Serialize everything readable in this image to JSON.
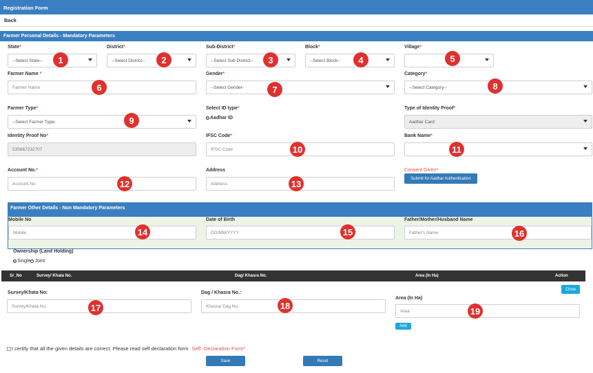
{
  "header": {
    "title": "Registration Form",
    "back_label": "Back"
  },
  "section1": {
    "title": "Farmer Personal Details - Mandatory Parameters"
  },
  "fields": {
    "state": {
      "label": "State",
      "value": "--Select State--"
    },
    "district": {
      "label": "District",
      "value": "--Select District--"
    },
    "sub_district": {
      "label": "Sub-District",
      "value": "--Select Sub District--"
    },
    "block": {
      "label": "Block",
      "value": "--Select Block--"
    },
    "village": {
      "label": "Village",
      "value": ""
    },
    "farmer_name": {
      "label": "Farmer Name",
      "placeholder": "Farmer Name"
    },
    "gender": {
      "label": "Gender",
      "value": "--Select Gender-"
    },
    "category": {
      "label": "Category",
      "value": "--Select Category--"
    },
    "farmer_type": {
      "label": "Farmer Type",
      "value": "--Select Farmer Type-"
    },
    "id_type": {
      "label": "Select ID type",
      "option": "Aadhar ID"
    },
    "identity_proof_type": {
      "label": "Type of Identity Proof",
      "value": "Aadhar Card"
    },
    "identity_proof_no": {
      "label": "Identity Proof No",
      "value": "535667232707"
    },
    "ifsc": {
      "label": "IFSC Code",
      "placeholder": "IFSC Code"
    },
    "bank_name": {
      "label": "Bank Name",
      "value": ""
    },
    "account_no": {
      "label": "Account No.",
      "placeholder": "Account No"
    },
    "address": {
      "label": "Address",
      "placeholder": "Address"
    },
    "consent": {
      "label": "Consent Given",
      "button_label": "Submit for Aadhar Authentication"
    }
  },
  "section2": {
    "title": "Farmer Other Details - Non Mandatory Parameters"
  },
  "other": {
    "mobile": {
      "label": "Mobile No",
      "placeholder": "Mobile"
    },
    "dob": {
      "label": "Date of Birth",
      "placeholder": "DD/MM/YYYY"
    },
    "father": {
      "label": "Father/Mother/Husband Name",
      "placeholder": "Father's Name"
    },
    "ownership": {
      "label": "Ownership (Land Holding)",
      "single": "Single",
      "joint": "Joint"
    }
  },
  "table": {
    "headers": [
      "Sr_No",
      "Survey/ Khata No.",
      "Dag/ Khasra No.",
      "Area (In Ha)",
      "Action"
    ],
    "close_label": "Close"
  },
  "land": {
    "survey": {
      "label": "Survey/Khata No:",
      "placeholder": "Survey/Khata No."
    },
    "dag": {
      "label": "Dag / Khasra No.:",
      "placeholder": "Khasra/ Dag No."
    },
    "area": {
      "label": "Area (In Ha)",
      "placeholder": "Area"
    },
    "add_label": "Add"
  },
  "footer": {
    "declaration": "I certify that all the given details are correct. Please read self declaration form",
    "link": "Self -Declaration Form",
    "save_label": "Save",
    "reset_label": "Reset"
  },
  "markers": [
    "1",
    "2",
    "3",
    "4",
    "5",
    "6",
    "7",
    "8",
    "9",
    "10",
    "11",
    "12",
    "13",
    "14",
    "15",
    "16",
    "17",
    "18",
    "19"
  ],
  "colors": {
    "primary": "#3a7fc1",
    "marker": "#e0312e",
    "required": "#d9534f",
    "button": "#337ab7",
    "table_header": "#333333",
    "action_button": "#1ca8dd"
  }
}
